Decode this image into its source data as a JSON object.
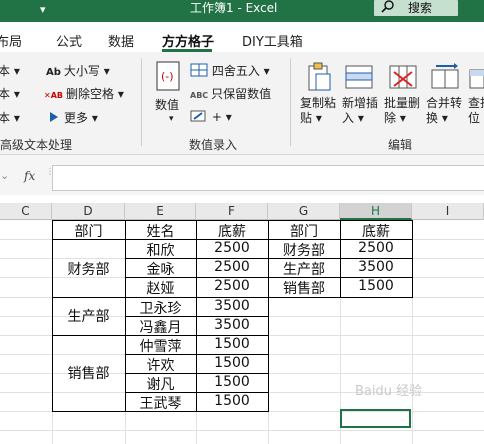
{
  "title_bar": {
    "title": "工作簿1  -  Excel",
    "search_label": "搜索",
    "menu_arrow": "▾"
  },
  "tabs": [
    {
      "label": "布局"
    },
    {
      "label": "公式"
    },
    {
      "label": "数据"
    },
    {
      "label": "方方格子"
    },
    {
      "label": "DIY工具箱"
    }
  ],
  "ribbon": {
    "text_group": {
      "left_items": [
        "本 ▾",
        "本 ▾",
        "本 ▾"
      ],
      "case_label": "大小写 ▾",
      "case_icon": "Ab",
      "delete_space_label": "删除空格 ▾",
      "delete_space_icon": "✕AB",
      "more_label": "更多 ▾",
      "group_label": "高级文本处理"
    },
    "number_group": {
      "value_label": "数值",
      "round_label": "四舍五入 ▾",
      "keep_value_label": "只保留数值",
      "keep_value_icon": "ABC",
      "plus_minus_label": "+ ▾",
      "group_label": "数值录入"
    },
    "edit_group": {
      "copy_paste_label": "复制粘\n贴 ▾",
      "add_insert_label": "新增插\n入 ▾",
      "batch_delete_label": "批量删\n除 ▾",
      "merge_label": "合并转\n换 ▾",
      "find_label": "查找\n位",
      "group_label": "编辑"
    }
  },
  "formula_bar": {
    "fx_label": "fx",
    "cancel_icon": "⌄"
  },
  "columns": [
    "C",
    "D",
    "E",
    "F",
    "G",
    "H",
    "I"
  ],
  "selected_column": "H",
  "table1": {
    "headers": [
      "部门",
      "姓名",
      "底薪"
    ],
    "groups": [
      {
        "dept": "财务部",
        "rows": [
          [
            "和欣",
            "2500"
          ],
          [
            "金咏",
            "2500"
          ],
          [
            "赵娅",
            "2500"
          ]
        ]
      },
      {
        "dept": "生产部",
        "rows": [
          [
            "卫永珍",
            "3500"
          ],
          [
            "冯鑫月",
            "3500"
          ]
        ]
      },
      {
        "dept": "销售部",
        "rows": [
          [
            "仲雪萍",
            "1500"
          ],
          [
            "许欢",
            "1500"
          ],
          [
            "谢凡",
            "1500"
          ],
          [
            "王武琴",
            "1500"
          ]
        ]
      }
    ]
  },
  "table2": {
    "headers": [
      "部门",
      "底薪"
    ],
    "rows": [
      [
        "财务部",
        "2500"
      ],
      [
        "生产部",
        "3500"
      ],
      [
        "销售部",
        "1500"
      ]
    ]
  },
  "watermark": "Baidu 经验",
  "colors": {
    "accent": "#217346"
  }
}
